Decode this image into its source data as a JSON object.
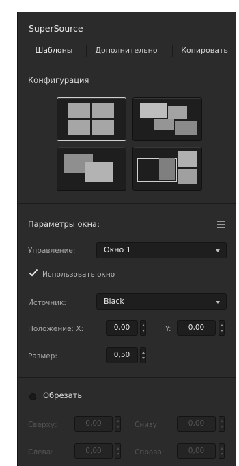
{
  "panel": {
    "title": "SuperSource"
  },
  "tabs": [
    {
      "label": "Шаблоны",
      "active": true
    },
    {
      "label": "Дополнительно",
      "active": false
    },
    {
      "label": "Копировать",
      "active": false
    }
  ],
  "templates": {
    "label": "Конфигурация",
    "selected_index": 0
  },
  "box_params": {
    "label": "Параметры окна:",
    "control_label": "Управление:",
    "control_value": "Окно 1",
    "enable_label": "Использовать окно",
    "enable_checked": true,
    "source_label": "Источник:",
    "source_value": "Black",
    "position_label": "Положение: X:",
    "position_x": "0,00",
    "y_label": "Y:",
    "position_y": "0,00",
    "size_label": "Размер:",
    "size_value": "0,50"
  },
  "crop": {
    "label": "Обрезать",
    "enabled": false,
    "top_label": "Сверху:",
    "top_value": "0,00",
    "bottom_label": "Снизу:",
    "bottom_value": "0,00",
    "left_label": "Слева:",
    "left_value": "0,00",
    "right_label": "Справа:",
    "right_value": "0,00"
  },
  "colors": {
    "panel_bg": "#2b2b2b",
    "field_bg": "#1e1e1e",
    "text": "#e8e8e8"
  }
}
